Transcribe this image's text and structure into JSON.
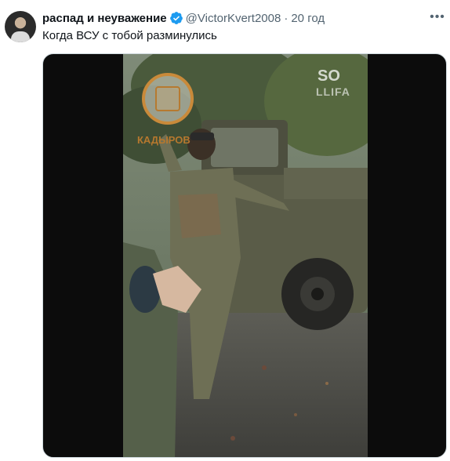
{
  "tweet": {
    "author_name": "распад и неуважение",
    "handle": "@VictorKvert2008",
    "separator": "·",
    "time": "20 год",
    "text": "Когда ВСУ с тобой разминулись",
    "verified": true
  },
  "media": {
    "type": "video",
    "watermark_logo_text": "КАДЫРОВ",
    "watermark_corner": "SO",
    "watermark_corner_sub": "LLIFA"
  },
  "icons": {
    "avatar": "user-avatar",
    "verified": "verified-badge-icon",
    "more": "more-options-icon"
  },
  "colors": {
    "verified": "#1d9bf0",
    "secondary_text": "#536471",
    "primary_text": "#0f1419"
  }
}
